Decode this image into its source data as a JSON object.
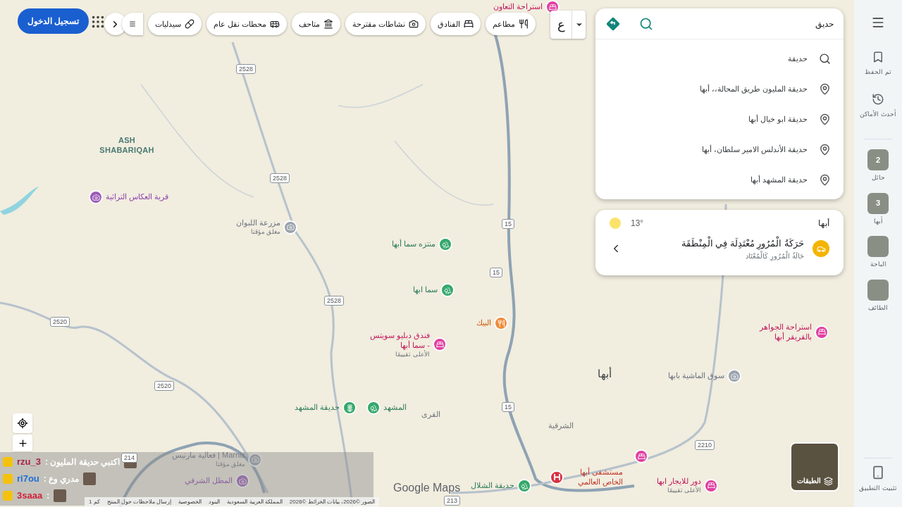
{
  "sign_in": "تسجيل الدخول",
  "categories": [
    "مطاعم",
    "الفنادق",
    "نشاطات مقترحة",
    "متاحف",
    "محطات نقل عام",
    "سيدليات"
  ],
  "input_tool": "ع",
  "search": {
    "value": "حديق"
  },
  "suggestions": [
    {
      "kind": "query",
      "text": "حديقة"
    },
    {
      "kind": "place",
      "text": "حديقة المليون طريق المحالة،، أبها"
    },
    {
      "kind": "place",
      "text": "حديقة ابو خيال أبها"
    },
    {
      "kind": "place",
      "text": "حديقة الأندلس الامير سلطان، أبها"
    },
    {
      "kind": "place",
      "text": "حديقة المشهد أبها"
    }
  ],
  "weather": {
    "city": "أبها",
    "temperature": "13°"
  },
  "traffic": {
    "title": "حَرَكَةُ الْمُرُورِ مُعْتَدِلَة فِي الْمِنْطَقَة",
    "subtitle": "حَالَةُ الْمُرُورِ كَالْمُعْتَاد"
  },
  "sidebar": {
    "saved": "تم الحفظ",
    "recent": "أحدث الأماكن",
    "places": [
      {
        "name": "حائل",
        "count": "2"
      },
      {
        "name": "أبها",
        "count": "3"
      },
      {
        "name": "الباحة"
      },
      {
        "name": "الطائف"
      }
    ],
    "install": "تثبيت التطبيق"
  },
  "layers": "الطبقات",
  "map": {
    "labels": [
      {
        "kind": "hotel",
        "text": "استراحة التعاون"
      },
      {
        "kind": "area",
        "text": "ASH SHABARIQAH"
      },
      {
        "kind": "attraction",
        "text": "قرية العكاس التراثية"
      },
      {
        "kind": "place",
        "text": "مزرعة اللبوان",
        "note": "مغلق مؤقتا"
      },
      {
        "kind": "park",
        "text": "منتزه سما أبها"
      },
      {
        "kind": "park",
        "text": "سما ابها"
      },
      {
        "kind": "food",
        "text": "البيك"
      },
      {
        "kind": "hotel",
        "text": "فندق دبليو سويتس - سما أبها",
        "note": "الأعلى تقييمًا"
      },
      {
        "kind": "park",
        "text": "المشهد"
      },
      {
        "kind": "garden",
        "text": "حديقة المشهد"
      },
      {
        "kind": "district",
        "text": "القرى"
      },
      {
        "kind": "city",
        "text": "أبها"
      },
      {
        "kind": "place",
        "text": "سوق الماشية بابها"
      },
      {
        "kind": "hotel",
        "text": "استراحة الجواهر بالقريقر أبها"
      },
      {
        "kind": "district",
        "text": "الشرقية"
      },
      {
        "kind": "hotel",
        "text": "دور للايجار ابها",
        "note": "الأعلى تقييمًا"
      },
      {
        "kind": "hospital",
        "text": "مستشفى أبها الخاص العالمي"
      },
      {
        "kind": "park",
        "text": "حديقة الشلال"
      },
      {
        "kind": "place",
        "text": "فعالية مارنيس | Marnis",
        "note": "مغلق مؤقتا"
      },
      {
        "kind": "attraction",
        "text": "المطل الشرقي"
      }
    ],
    "shields": [
      "2528",
      "2528",
      "2528",
      "2520",
      "2520",
      "15",
      "15",
      "15",
      "2210",
      "214",
      "213"
    ]
  },
  "chat": [
    {
      "user": "rzu_3",
      "message": "اكتبي حديقة المليون :"
    },
    {
      "user": "ri7ou",
      "message": "مدري وع :"
    },
    {
      "user": "3saaa",
      "message": ":"
    }
  ],
  "logo": "Google Maps",
  "footer": {
    "scale": "1 كم",
    "links": [
      "الصور ©2026، بيانات الخرائط ©2026",
      "المملكة العربية السعودية",
      "البنود",
      "الخصوصية",
      "إرسال ملاحظات حول المنتج"
    ]
  }
}
